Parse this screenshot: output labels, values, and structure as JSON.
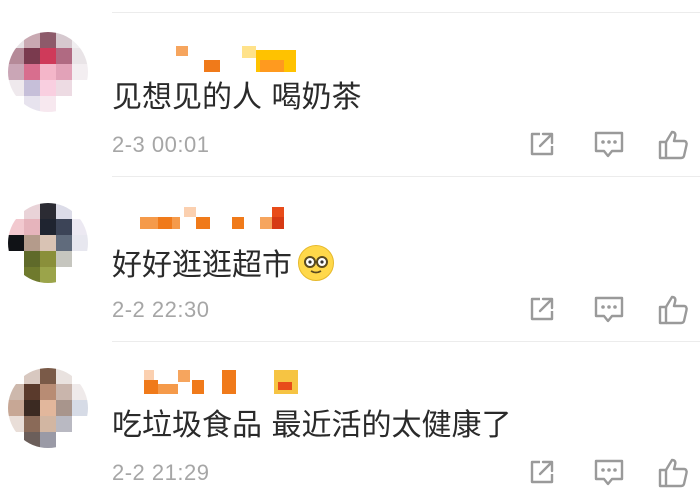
{
  "comments": [
    {
      "text": "见想见的人 喝奶茶",
      "timestamp": "2-3 00:01",
      "has_emoji": false,
      "emoji": ""
    },
    {
      "text": "好好逛逛超市",
      "timestamp": "2-2 22:30",
      "has_emoji": true,
      "emoji": "face-with-glasses-emoji"
    },
    {
      "text": "吃垃圾食品 最近活的太健康了",
      "timestamp": "2-2 21:29",
      "has_emoji": false,
      "emoji": ""
    }
  ],
  "icons": {
    "share": "share-icon",
    "reply": "comment-icon",
    "like": "like-icon"
  },
  "colors": {
    "text": "#2a2a2a",
    "timestamp": "#a6a6a6",
    "icon": "#9a9a9a",
    "username_orange": "#f07a1a",
    "divider": "#ececec"
  }
}
